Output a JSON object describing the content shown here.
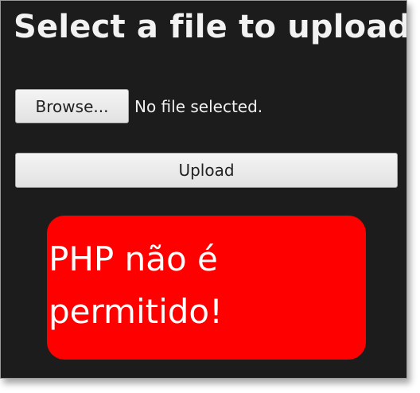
{
  "form": {
    "title": "Select a file to upload:",
    "browse_label": "Browse...",
    "file_status": "No file selected.",
    "upload_label": "Upload"
  },
  "alert": {
    "lines": [
      "PHP não é",
      "permitido!"
    ]
  },
  "colors": {
    "background": "#1c1c1c",
    "alert": "#ff0000",
    "button": "#ececec"
  }
}
